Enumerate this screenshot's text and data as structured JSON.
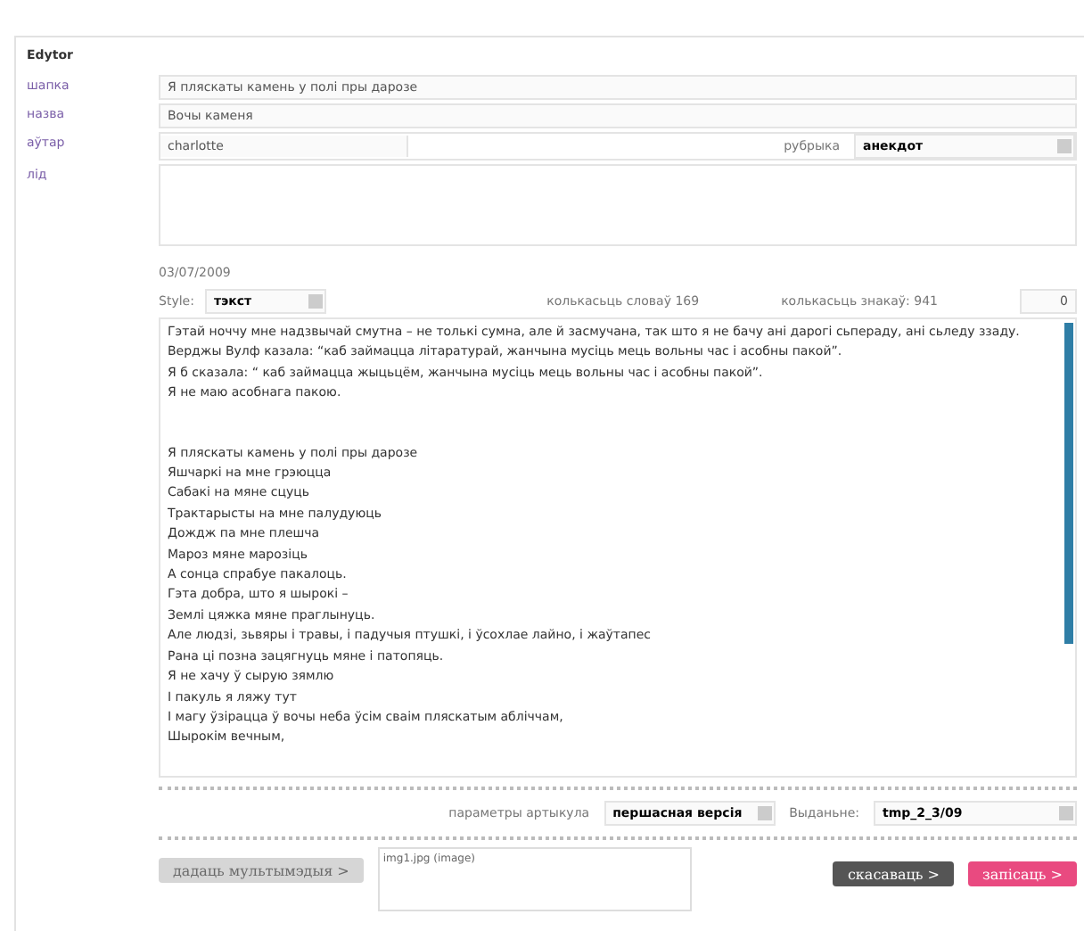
{
  "title": "Edytor",
  "fields": [
    {
      "kind": "text",
      "label": "шапка",
      "value": "Я пляскаты камень у полі пры дарозе"
    },
    {
      "kind": "text",
      "label": "назва",
      "value": "Вочы каменя"
    },
    {
      "kind": "author",
      "label": "аўтар",
      "value": "charlotte",
      "select_label": "рубрыка",
      "select_value": "анекдот"
    },
    {
      "kind": "textarea",
      "label": "лід"
    }
  ],
  "date": "03/07/2009",
  "style": {
    "label": "Style:",
    "value": "тэкст"
  },
  "counts": [
    "колькасьць словаў 169",
    "колькасьць знакаў: 941"
  ],
  "counter_value": "0",
  "body_blocks": [
    [
      "Гэтай ноччу мне надзвычай смутна – не толькі сумна, але й засмучана, так што я не бачу ані дарогі сьпераду, ані сьледу ззаду. Верджы Вулф казала: “каб займацца літаратурай, жанчына мусіць мець вольны час і асобны пакой”.",
      "Я б сказала: “ каб займацца жыцьцём, жанчына мусіць мець вольны час і асобны пакой”.",
      "Я не маю асобнага пакою."
    ],
    [
      "Я пляскаты камень у полі пры дарозе",
      "Яшчаркі на мне грэюцца",
      "Сабакі на мяне сцуць",
      "Трактарысты на мне палудуюць",
      "Дождж па мне плешча",
      "Мароз мяне марозіць",
      "А сонца спрабуе пакалоць.",
      "Гэта добра, што я шырокі –",
      "Землі цяжка мяне праглынуць.",
      "Але людзі, зьвяры і травы, і падучыя птушкі, і ўсохлае лайно, і жаўтапес",
      "Рана ці позна зацягнуць мяне і патопяць.",
      "Я не хачу ў сырую зямлю",
      "І пакуль я ляжу тут",
      "І магу ўзірацца ў вочы неба ўсім сваім пляскатым абліччам,",
      "Шырокім вечным,"
    ]
  ],
  "params": [
    {
      "label": "параметры артыкула",
      "value": "першасная версія"
    },
    {
      "label": "Выданьне:",
      "value": "tmp_2_3/09"
    }
  ],
  "media_button": {
    "label": "дадаць мультымэдыя >",
    "disabled": true
  },
  "media_list": [
    "img1.jpg (image)"
  ],
  "actions": [
    {
      "kind": "cancel",
      "label": "скасаваць >"
    },
    {
      "kind": "save",
      "label": "запісаць >"
    }
  ]
}
